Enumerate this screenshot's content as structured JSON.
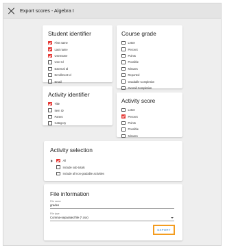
{
  "window": {
    "title": "Export scores - Algebra I"
  },
  "student_identifier": {
    "title": "Student identifier",
    "options": [
      {
        "label": "First name",
        "checked": true
      },
      {
        "label": "Last name",
        "checked": true
      },
      {
        "label": "Username",
        "checked": true
      },
      {
        "label": "User Id",
        "checked": false
      },
      {
        "label": "External Id",
        "checked": false
      },
      {
        "label": "Enrollment Id",
        "checked": false
      },
      {
        "label": "Email",
        "checked": false
      }
    ]
  },
  "course_grade": {
    "title": "Course grade",
    "options": [
      {
        "label": "Letter",
        "checked": false
      },
      {
        "label": "Percent",
        "checked": false
      },
      {
        "label": "Points",
        "checked": false
      },
      {
        "label": "Possible",
        "checked": false
      },
      {
        "label": "Minutes",
        "checked": false
      },
      {
        "label": "Reported",
        "checked": false
      },
      {
        "label": "Gradable Completion",
        "checked": false
      },
      {
        "label": "Overall Completion",
        "checked": false
      }
    ]
  },
  "activity_identifier": {
    "title": "Activity identifier",
    "options": [
      {
        "label": "Title",
        "checked": true
      },
      {
        "label": "Item ID",
        "checked": false
      },
      {
        "label": "Parent",
        "checked": false
      },
      {
        "label": "Category",
        "checked": false
      }
    ]
  },
  "activity_score": {
    "title": "Activity score",
    "options": [
      {
        "label": "Letter",
        "checked": false
      },
      {
        "label": "Percent",
        "checked": true
      },
      {
        "label": "Points",
        "checked": false
      },
      {
        "label": "Possible",
        "checked": false
      },
      {
        "label": "Minutes",
        "checked": false
      }
    ]
  },
  "activity_selection": {
    "title": "Activity selection",
    "all": {
      "label": "All",
      "checked": true
    },
    "options": [
      {
        "label": "Include sub-totals",
        "checked": false
      },
      {
        "label": "Include all non-gradable activities",
        "checked": false
      }
    ]
  },
  "file_information": {
    "title": "File information",
    "file_name": {
      "label": "File name",
      "value": "grades"
    },
    "file_type": {
      "label": "File type",
      "value": "Comma-separated file (*.csv)"
    },
    "export_label": "EXPORT"
  },
  "colors": {
    "checkbox_checked": "#e53935",
    "export_text": "#3a8ad6",
    "export_highlight": "#f39c1f"
  },
  "icons": {
    "close": "close-icon",
    "expand": "chevron-right-icon",
    "dropdown": "dropdown-arrow-icon"
  }
}
